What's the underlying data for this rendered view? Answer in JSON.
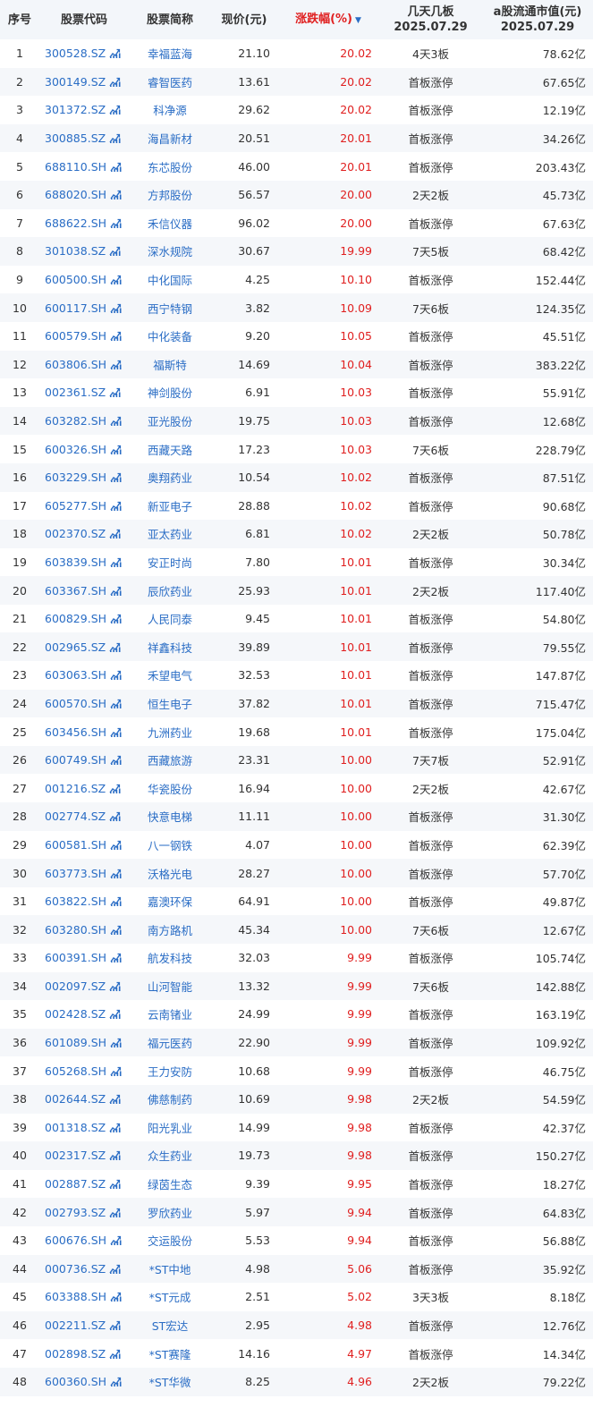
{
  "header": {
    "index": "序号",
    "code": "股票代码",
    "name": "股票简称",
    "price": "现价(元)",
    "change": "涨跌幅(%)",
    "board_line1": "几天几板",
    "board_line2": "2025.07.29",
    "cap_line1": "a股流通市值(元)",
    "cap_line2": "2025.07.29"
  },
  "icons": {
    "sort": "sort-desc-icon",
    "chart": "chart-icon"
  },
  "colors": {
    "link": "#2a6dc5",
    "up": "#e02020",
    "header_bg": "#f3f6fa",
    "stripe": "#f5f7fa"
  },
  "rows": [
    {
      "idx": "1",
      "code": "300528.SZ",
      "name": "幸福蓝海",
      "price": "21.10",
      "chg": "20.02",
      "board": "4天3板",
      "cap": "78.62亿"
    },
    {
      "idx": "2",
      "code": "300149.SZ",
      "name": "睿智医药",
      "price": "13.61",
      "chg": "20.02",
      "board": "首板涨停",
      "cap": "67.65亿"
    },
    {
      "idx": "3",
      "code": "301372.SZ",
      "name": "科净源",
      "price": "29.62",
      "chg": "20.02",
      "board": "首板涨停",
      "cap": "12.19亿"
    },
    {
      "idx": "4",
      "code": "300885.SZ",
      "name": "海昌新材",
      "price": "20.51",
      "chg": "20.01",
      "board": "首板涨停",
      "cap": "34.26亿"
    },
    {
      "idx": "5",
      "code": "688110.SH",
      "name": "东芯股份",
      "price": "46.00",
      "chg": "20.01",
      "board": "首板涨停",
      "cap": "203.43亿"
    },
    {
      "idx": "6",
      "code": "688020.SH",
      "name": "方邦股份",
      "price": "56.57",
      "chg": "20.00",
      "board": "2天2板",
      "cap": "45.73亿"
    },
    {
      "idx": "7",
      "code": "688622.SH",
      "name": "禾信仪器",
      "price": "96.02",
      "chg": "20.00",
      "board": "首板涨停",
      "cap": "67.63亿"
    },
    {
      "idx": "8",
      "code": "301038.SZ",
      "name": "深水规院",
      "price": "30.67",
      "chg": "19.99",
      "board": "7天5板",
      "cap": "68.42亿"
    },
    {
      "idx": "9",
      "code": "600500.SH",
      "name": "中化国际",
      "price": "4.25",
      "chg": "10.10",
      "board": "首板涨停",
      "cap": "152.44亿"
    },
    {
      "idx": "10",
      "code": "600117.SH",
      "name": "西宁特钢",
      "price": "3.82",
      "chg": "10.09",
      "board": "7天6板",
      "cap": "124.35亿"
    },
    {
      "idx": "11",
      "code": "600579.SH",
      "name": "中化装备",
      "price": "9.20",
      "chg": "10.05",
      "board": "首板涨停",
      "cap": "45.51亿"
    },
    {
      "idx": "12",
      "code": "603806.SH",
      "name": "福斯特",
      "price": "14.69",
      "chg": "10.04",
      "board": "首板涨停",
      "cap": "383.22亿"
    },
    {
      "idx": "13",
      "code": "002361.SZ",
      "name": "神剑股份",
      "price": "6.91",
      "chg": "10.03",
      "board": "首板涨停",
      "cap": "55.91亿"
    },
    {
      "idx": "14",
      "code": "603282.SH",
      "name": "亚光股份",
      "price": "19.75",
      "chg": "10.03",
      "board": "首板涨停",
      "cap": "12.68亿"
    },
    {
      "idx": "15",
      "code": "600326.SH",
      "name": "西藏天路",
      "price": "17.23",
      "chg": "10.03",
      "board": "7天6板",
      "cap": "228.79亿"
    },
    {
      "idx": "16",
      "code": "603229.SH",
      "name": "奥翔药业",
      "price": "10.54",
      "chg": "10.02",
      "board": "首板涨停",
      "cap": "87.51亿"
    },
    {
      "idx": "17",
      "code": "605277.SH",
      "name": "新亚电子",
      "price": "28.88",
      "chg": "10.02",
      "board": "首板涨停",
      "cap": "90.68亿"
    },
    {
      "idx": "18",
      "code": "002370.SZ",
      "name": "亚太药业",
      "price": "6.81",
      "chg": "10.02",
      "board": "2天2板",
      "cap": "50.78亿"
    },
    {
      "idx": "19",
      "code": "603839.SH",
      "name": "安正时尚",
      "price": "7.80",
      "chg": "10.01",
      "board": "首板涨停",
      "cap": "30.34亿"
    },
    {
      "idx": "20",
      "code": "603367.SH",
      "name": "辰欣药业",
      "price": "25.93",
      "chg": "10.01",
      "board": "2天2板",
      "cap": "117.40亿"
    },
    {
      "idx": "21",
      "code": "600829.SH",
      "name": "人民同泰",
      "price": "9.45",
      "chg": "10.01",
      "board": "首板涨停",
      "cap": "54.80亿"
    },
    {
      "idx": "22",
      "code": "002965.SZ",
      "name": "祥鑫科技",
      "price": "39.89",
      "chg": "10.01",
      "board": "首板涨停",
      "cap": "79.55亿"
    },
    {
      "idx": "23",
      "code": "603063.SH",
      "name": "禾望电气",
      "price": "32.53",
      "chg": "10.01",
      "board": "首板涨停",
      "cap": "147.87亿"
    },
    {
      "idx": "24",
      "code": "600570.SH",
      "name": "恒生电子",
      "price": "37.82",
      "chg": "10.01",
      "board": "首板涨停",
      "cap": "715.47亿"
    },
    {
      "idx": "25",
      "code": "603456.SH",
      "name": "九洲药业",
      "price": "19.68",
      "chg": "10.01",
      "board": "首板涨停",
      "cap": "175.04亿"
    },
    {
      "idx": "26",
      "code": "600749.SH",
      "name": "西藏旅游",
      "price": "23.31",
      "chg": "10.00",
      "board": "7天7板",
      "cap": "52.91亿"
    },
    {
      "idx": "27",
      "code": "001216.SZ",
      "name": "华瓷股份",
      "price": "16.94",
      "chg": "10.00",
      "board": "2天2板",
      "cap": "42.67亿"
    },
    {
      "idx": "28",
      "code": "002774.SZ",
      "name": "快意电梯",
      "price": "11.11",
      "chg": "10.00",
      "board": "首板涨停",
      "cap": "31.30亿"
    },
    {
      "idx": "29",
      "code": "600581.SH",
      "name": "八一钢铁",
      "price": "4.07",
      "chg": "10.00",
      "board": "首板涨停",
      "cap": "62.39亿"
    },
    {
      "idx": "30",
      "code": "603773.SH",
      "name": "沃格光电",
      "price": "28.27",
      "chg": "10.00",
      "board": "首板涨停",
      "cap": "57.70亿"
    },
    {
      "idx": "31",
      "code": "603822.SH",
      "name": "嘉澳环保",
      "price": "64.91",
      "chg": "10.00",
      "board": "首板涨停",
      "cap": "49.87亿"
    },
    {
      "idx": "32",
      "code": "603280.SH",
      "name": "南方路机",
      "price": "45.34",
      "chg": "10.00",
      "board": "7天6板",
      "cap": "12.67亿"
    },
    {
      "idx": "33",
      "code": "600391.SH",
      "name": "航发科技",
      "price": "32.03",
      "chg": "9.99",
      "board": "首板涨停",
      "cap": "105.74亿"
    },
    {
      "idx": "34",
      "code": "002097.SZ",
      "name": "山河智能",
      "price": "13.32",
      "chg": "9.99",
      "board": "7天6板",
      "cap": "142.88亿"
    },
    {
      "idx": "35",
      "code": "002428.SZ",
      "name": "云南锗业",
      "price": "24.99",
      "chg": "9.99",
      "board": "首板涨停",
      "cap": "163.19亿"
    },
    {
      "idx": "36",
      "code": "601089.SH",
      "name": "福元医药",
      "price": "22.90",
      "chg": "9.99",
      "board": "首板涨停",
      "cap": "109.92亿"
    },
    {
      "idx": "37",
      "code": "605268.SH",
      "name": "王力安防",
      "price": "10.68",
      "chg": "9.99",
      "board": "首板涨停",
      "cap": "46.75亿"
    },
    {
      "idx": "38",
      "code": "002644.SZ",
      "name": "佛慈制药",
      "price": "10.69",
      "chg": "9.98",
      "board": "2天2板",
      "cap": "54.59亿"
    },
    {
      "idx": "39",
      "code": "001318.SZ",
      "name": "阳光乳业",
      "price": "14.99",
      "chg": "9.98",
      "board": "首板涨停",
      "cap": "42.37亿"
    },
    {
      "idx": "40",
      "code": "002317.SZ",
      "name": "众生药业",
      "price": "19.73",
      "chg": "9.98",
      "board": "首板涨停",
      "cap": "150.27亿"
    },
    {
      "idx": "41",
      "code": "002887.SZ",
      "name": "绿茵生态",
      "price": "9.39",
      "chg": "9.95",
      "board": "首板涨停",
      "cap": "18.27亿"
    },
    {
      "idx": "42",
      "code": "002793.SZ",
      "name": "罗欣药业",
      "price": "5.97",
      "chg": "9.94",
      "board": "首板涨停",
      "cap": "64.83亿"
    },
    {
      "idx": "43",
      "code": "600676.SH",
      "name": "交运股份",
      "price": "5.53",
      "chg": "9.94",
      "board": "首板涨停",
      "cap": "56.88亿"
    },
    {
      "idx": "44",
      "code": "000736.SZ",
      "name": "*ST中地",
      "price": "4.98",
      "chg": "5.06",
      "board": "首板涨停",
      "cap": "35.92亿"
    },
    {
      "idx": "45",
      "code": "603388.SH",
      "name": "*ST元成",
      "price": "2.51",
      "chg": "5.02",
      "board": "3天3板",
      "cap": "8.18亿"
    },
    {
      "idx": "46",
      "code": "002211.SZ",
      "name": "ST宏达",
      "price": "2.95",
      "chg": "4.98",
      "board": "首板涨停",
      "cap": "12.76亿"
    },
    {
      "idx": "47",
      "code": "002898.SZ",
      "name": "*ST赛隆",
      "price": "14.16",
      "chg": "4.97",
      "board": "首板涨停",
      "cap": "14.34亿"
    },
    {
      "idx": "48",
      "code": "600360.SH",
      "name": "*ST华微",
      "price": "8.25",
      "chg": "4.96",
      "board": "2天2板",
      "cap": "79.22亿"
    }
  ]
}
